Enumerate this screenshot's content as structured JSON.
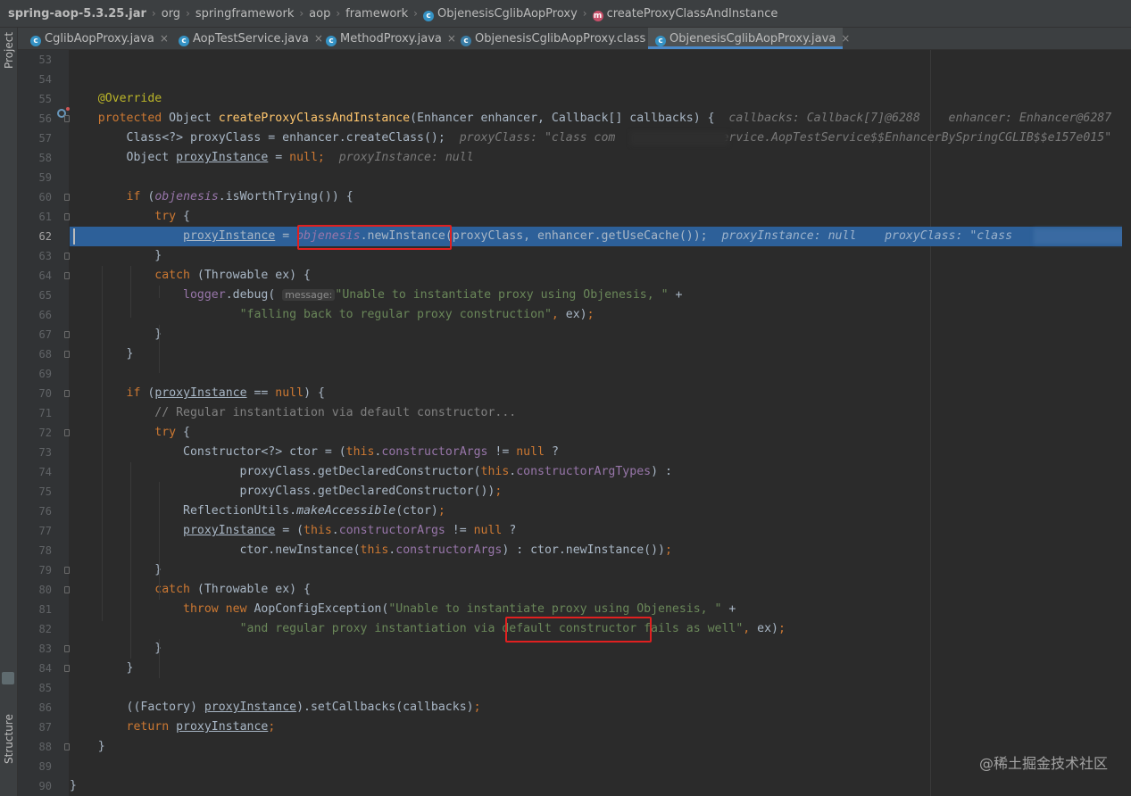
{
  "breadcrumbs": [
    "spring-aop-5.3.25.jar",
    "org",
    "springframework",
    "aop",
    "framework",
    "ObjenesisCglibAopProxy",
    "createProxyClassAndInstance"
  ],
  "left_tool_windows": [
    "Project",
    "Structure"
  ],
  "tabs": [
    {
      "label": "CglibAopProxy.java",
      "icon": "class-icon"
    },
    {
      "label": "AopTestService.java",
      "icon": "class-icon"
    },
    {
      "label": "MethodProxy.java",
      "icon": "class-icon"
    },
    {
      "label": "ObjenesisCglibAopProxy.class",
      "icon": "class-file-icon"
    },
    {
      "label": "ObjenesisCglibAopProxy.java",
      "icon": "class-icon",
      "active": true
    }
  ],
  "editor": {
    "current_line": 62,
    "lines": [
      {
        "n": "53",
        "t": []
      },
      {
        "n": "54",
        "t": []
      },
      {
        "n": "55",
        "t": [
          [
            "",
            "    "
          ],
          [
            "ann",
            "@Override"
          ]
        ]
      },
      {
        "n": "56",
        "t": [
          [
            "",
            "    "
          ],
          [
            "kw",
            "protected "
          ],
          [
            "",
            "Object "
          ],
          [
            "fn",
            "createProxyClassAndInstance"
          ],
          [
            "",
            "(Enhancer enhancer, Callback[] callbacks) {  "
          ],
          [
            "inlay",
            "callbacks: Callback[7]@6288    enhancer: Enhancer@6287"
          ]
        ]
      },
      {
        "n": "57",
        "t": [
          [
            "",
            "        Class<?> proxyClass = enhancer.createClass();  "
          ],
          [
            "inlay",
            "proxyClass: \"class com"
          ],
          [
            "",
            "               "
          ],
          [
            "inlay",
            "ervice.AopTestService$$EnhancerBySpringCGLIB$$e157e015\""
          ]
        ]
      },
      {
        "n": "58",
        "t": [
          [
            "",
            "        Object "
          ],
          [
            "var",
            "proxyInstance"
          ],
          [
            "",
            " = "
          ],
          [
            "kw",
            "null"
          ],
          [
            "kw",
            ";"
          ],
          [
            "",
            "  "
          ],
          [
            "inlay",
            "proxyInstance: null"
          ]
        ]
      },
      {
        "n": "59",
        "t": []
      },
      {
        "n": "60",
        "t": [
          [
            "",
            "        "
          ],
          [
            "kw",
            "if "
          ],
          [
            "",
            "("
          ],
          [
            "ifield",
            "objenesis"
          ],
          [
            "",
            ".isWorthTrying()) {"
          ]
        ]
      },
      {
        "n": "61",
        "t": [
          [
            "",
            "            "
          ],
          [
            "kw",
            "try "
          ],
          [
            "",
            "{"
          ]
        ]
      },
      {
        "n": "62",
        "t": [
          [
            "",
            "                "
          ],
          [
            "var",
            "proxyInstance"
          ],
          [
            "",
            " = "
          ],
          [
            "ifield",
            "objenesis"
          ],
          [
            "",
            ".newInstance(proxyClass, enhancer.getUseCache());  "
          ],
          [
            "inlay",
            "proxyInstance: null    proxyClass: \"class"
          ]
        ]
      },
      {
        "n": "63",
        "t": [
          [
            "",
            "            }"
          ]
        ]
      },
      {
        "n": "64",
        "t": [
          [
            "",
            "            "
          ],
          [
            "kw",
            "catch "
          ],
          [
            "",
            "(Throwable ex) {"
          ]
        ]
      },
      {
        "n": "65",
        "t": [
          [
            "",
            "                "
          ],
          [
            "field",
            "logger"
          ],
          [
            "",
            ".debug( "
          ],
          [
            "hint",
            "message:"
          ],
          [
            "str",
            "\"Unable to instantiate proxy using Objenesis, \" "
          ],
          [
            "",
            "+"
          ]
        ]
      },
      {
        "n": "66",
        "t": [
          [
            "",
            "                        "
          ],
          [
            "str",
            "\"falling back to regular proxy construction\""
          ],
          [
            "kw",
            ", "
          ],
          [
            "",
            "ex)"
          ],
          [
            "kw",
            ";"
          ]
        ]
      },
      {
        "n": "67",
        "t": [
          [
            "",
            "            }"
          ]
        ]
      },
      {
        "n": "68",
        "t": [
          [
            "",
            "        }"
          ]
        ]
      },
      {
        "n": "69",
        "t": []
      },
      {
        "n": "70",
        "t": [
          [
            "",
            "        "
          ],
          [
            "kw",
            "if "
          ],
          [
            "",
            "("
          ],
          [
            "var",
            "proxyInstance"
          ],
          [
            "",
            " == "
          ],
          [
            "kw",
            "null"
          ],
          [
            "",
            ") {"
          ]
        ]
      },
      {
        "n": "71",
        "t": [
          [
            "",
            "            "
          ],
          [
            "cmt",
            "// Regular instantiation via default constructor..."
          ]
        ]
      },
      {
        "n": "72",
        "t": [
          [
            "",
            "            "
          ],
          [
            "kw",
            "try "
          ],
          [
            "",
            "{"
          ]
        ]
      },
      {
        "n": "73",
        "t": [
          [
            "",
            "                Constructor<?> ctor = ("
          ],
          [
            "kw",
            "this"
          ],
          [
            "",
            "."
          ],
          [
            "field",
            "constructorArgs"
          ],
          [
            "",
            " != "
          ],
          [
            "kw",
            "null "
          ],
          [
            "",
            "?"
          ]
        ]
      },
      {
        "n": "74",
        "t": [
          [
            "",
            "                        proxyClass.getDeclaredConstructor("
          ],
          [
            "kw",
            "this"
          ],
          [
            "",
            "."
          ],
          [
            "field",
            "constructorArgTypes"
          ],
          [
            "",
            ") :"
          ]
        ]
      },
      {
        "n": "75",
        "t": [
          [
            "",
            "                        proxyClass.getDeclaredConstructor())"
          ],
          [
            "kw",
            ";"
          ]
        ]
      },
      {
        "n": "76",
        "t": [
          [
            "",
            "                ReflectionUtils."
          ],
          [
            "ital",
            "makeAccessible"
          ],
          [
            "",
            "(ctor)"
          ],
          [
            "kw",
            ";"
          ]
        ]
      },
      {
        "n": "77",
        "t": [
          [
            "",
            "                "
          ],
          [
            "var",
            "proxyInstance"
          ],
          [
            "",
            " = ("
          ],
          [
            "kw",
            "this"
          ],
          [
            "",
            "."
          ],
          [
            "field",
            "constructorArgs"
          ],
          [
            "",
            " != "
          ],
          [
            "kw",
            "null "
          ],
          [
            "",
            "?"
          ]
        ]
      },
      {
        "n": "78",
        "t": [
          [
            "",
            "                        ctor.newInstance("
          ],
          [
            "kw",
            "this"
          ],
          [
            "",
            "."
          ],
          [
            "field",
            "constructorArgs"
          ],
          [
            "",
            ") : ctor.newInstance())"
          ],
          [
            "kw",
            ";"
          ]
        ]
      },
      {
        "n": "79",
        "t": [
          [
            "",
            "            }"
          ]
        ]
      },
      {
        "n": "80",
        "t": [
          [
            "",
            "            "
          ],
          [
            "kw",
            "catch "
          ],
          [
            "",
            "(Throwable ex) {"
          ]
        ]
      },
      {
        "n": "81",
        "t": [
          [
            "",
            "                "
          ],
          [
            "kw",
            "throw new "
          ],
          [
            "",
            "AopConfigException("
          ],
          [
            "str",
            "\"Unable to instantiate proxy using Objenesis, \" "
          ],
          [
            "",
            "+"
          ]
        ]
      },
      {
        "n": "82",
        "t": [
          [
            "",
            "                        "
          ],
          [
            "str",
            "\"and regular proxy instantiation via default constructor fails as well\""
          ],
          [
            "kw",
            ", "
          ],
          [
            "",
            "ex)"
          ],
          [
            "kw",
            ";"
          ]
        ]
      },
      {
        "n": "83",
        "t": [
          [
            "",
            "            }"
          ]
        ]
      },
      {
        "n": "84",
        "t": [
          [
            "",
            "        }"
          ]
        ]
      },
      {
        "n": "85",
        "t": []
      },
      {
        "n": "86",
        "t": [
          [
            "",
            "        ((Factory) "
          ],
          [
            "var",
            "proxyInstance"
          ],
          [
            "",
            ").setCallbacks(callbacks)"
          ],
          [
            "kw",
            ";"
          ]
        ]
      },
      {
        "n": "87",
        "t": [
          [
            "",
            "        "
          ],
          [
            "kw",
            "return "
          ],
          [
            "var",
            "proxyInstance"
          ],
          [
            "kw",
            ";"
          ]
        ]
      },
      {
        "n": "88",
        "t": [
          [
            "",
            "    }"
          ]
        ]
      },
      {
        "n": "89",
        "t": []
      },
      {
        "n": "90",
        "t": [
          [
            "",
            "}"
          ]
        ]
      }
    ]
  },
  "watermark": "@稀土掘金技术社区",
  "colors": {
    "keyword": "#cc7832",
    "string": "#6a8759",
    "field": "#9876aa",
    "annotation": "#bbb529",
    "method": "#ffc66d",
    "highlight": "#2d6099",
    "annotation_box": "#e02020"
  }
}
